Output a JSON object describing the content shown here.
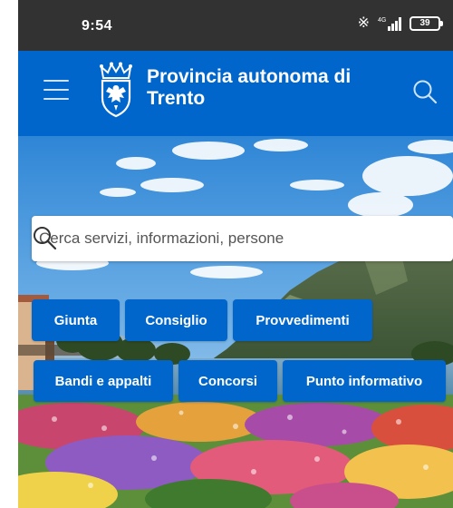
{
  "status_bar": {
    "time": "9:54",
    "network": "4G",
    "battery": "39",
    "icons": [
      "bluetooth-icon",
      "signal-icon",
      "battery-icon"
    ]
  },
  "header": {
    "title": "Provincia autonoma di Trento",
    "menu_icon": "hamburger-menu-icon",
    "search_icon": "search-icon",
    "logo": "coat-of-arms-logo",
    "background_color": "#0066cc"
  },
  "search": {
    "placeholder": "Cerca servizi, informazioni, persone"
  },
  "quick_links": {
    "row1": [
      "Giunta",
      "Consiglio",
      "Provvedimenti"
    ],
    "row2": [
      "Bandi e appalti",
      "Concorsi",
      "Punto informativo"
    ]
  },
  "accent_color": "#0066cc"
}
